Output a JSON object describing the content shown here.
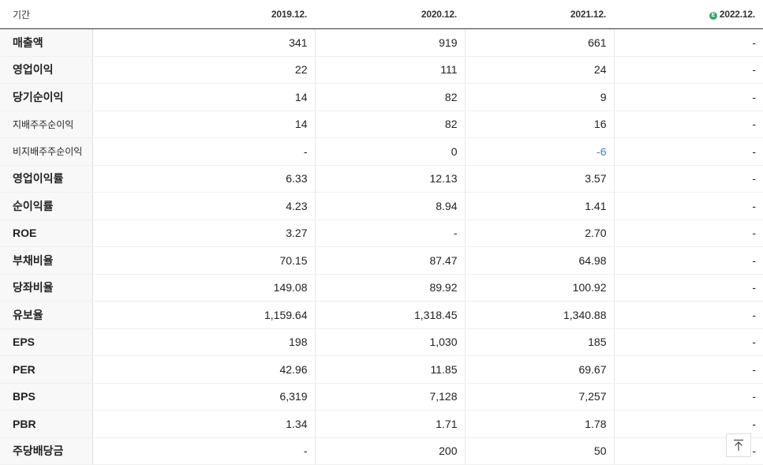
{
  "header": {
    "period_label": "기간",
    "periods": [
      "2019.12.",
      "2020.12.",
      "2021.12.",
      "2022.12."
    ],
    "estimate_badge": "E"
  },
  "rows": [
    {
      "label": "매출액",
      "values": [
        "341",
        "919",
        "661",
        "-"
      ]
    },
    {
      "label": "영업이익",
      "values": [
        "22",
        "111",
        "24",
        "-"
      ]
    },
    {
      "label": "당기순이익",
      "values": [
        "14",
        "82",
        "9",
        "-"
      ]
    },
    {
      "label": "지배주주순이익",
      "values": [
        "14",
        "82",
        "16",
        "-"
      ]
    },
    {
      "label": "비지배주주순이익",
      "values": [
        "-",
        "0",
        "-6",
        "-"
      ]
    },
    {
      "label": "영업이익률",
      "values": [
        "6.33",
        "12.13",
        "3.57",
        "-"
      ]
    },
    {
      "label": "순이익률",
      "values": [
        "4.23",
        "8.94",
        "1.41",
        "-"
      ]
    },
    {
      "label": "ROE",
      "values": [
        "3.27",
        "-",
        "2.70",
        "-"
      ]
    },
    {
      "label": "부채비율",
      "values": [
        "70.15",
        "87.47",
        "64.98",
        "-"
      ]
    },
    {
      "label": "당좌비율",
      "values": [
        "149.08",
        "89.92",
        "100.92",
        "-"
      ]
    },
    {
      "label": "유보율",
      "values": [
        "1,159.64",
        "1,318.45",
        "1,340.88",
        "-"
      ]
    },
    {
      "label": "EPS",
      "values": [
        "198",
        "1,030",
        "185",
        "-"
      ]
    },
    {
      "label": "PER",
      "values": [
        "42.96",
        "11.85",
        "69.67",
        "-"
      ]
    },
    {
      "label": "BPS",
      "values": [
        "6,319",
        "7,128",
        "7,257",
        "-"
      ]
    },
    {
      "label": "PBR",
      "values": [
        "1.34",
        "1.71",
        "1.78",
        "-"
      ]
    },
    {
      "label": "주당배당금",
      "values": [
        "-",
        "200",
        "50",
        "-"
      ]
    }
  ],
  "colors": {
    "negative": "#3a84c6",
    "estimate_badge": "#2fa865"
  },
  "top_button": {
    "icon": "arrow-up-to-top-icon"
  }
}
